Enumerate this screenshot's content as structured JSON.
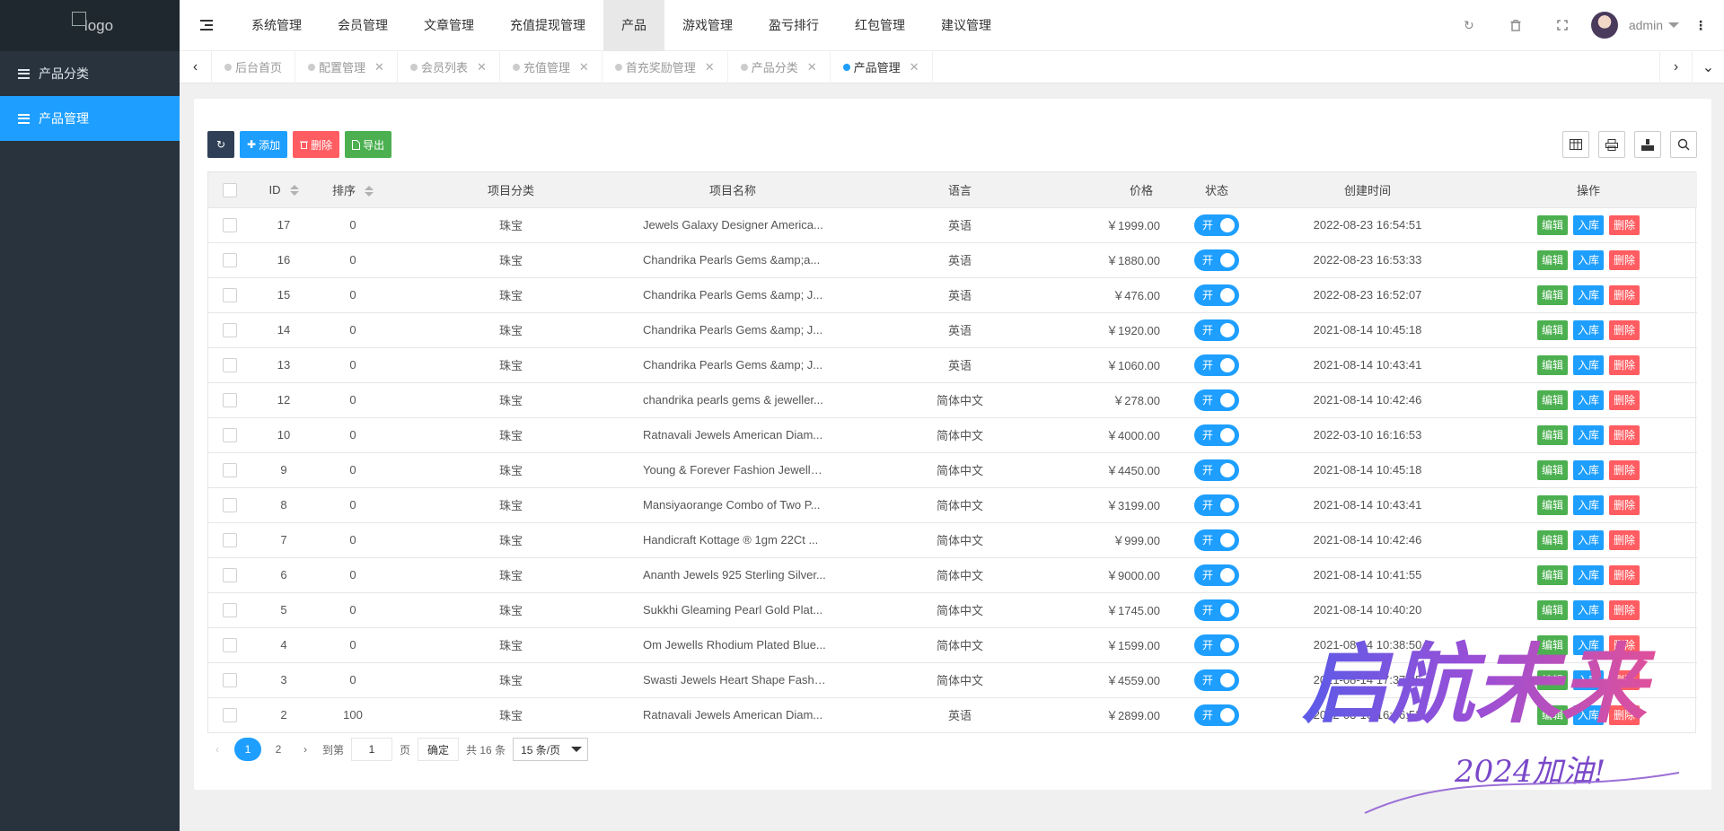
{
  "sidebar": {
    "logo_alt": "logo",
    "items": [
      {
        "label": "产品分类",
        "active": false
      },
      {
        "label": "产品管理",
        "active": true
      }
    ]
  },
  "header": {
    "nav": [
      {
        "label": "系统管理",
        "active": false
      },
      {
        "label": "会员管理",
        "active": false
      },
      {
        "label": "文章管理",
        "active": false
      },
      {
        "label": "充值提现管理",
        "active": false
      },
      {
        "label": "产品",
        "active": true
      },
      {
        "label": "游戏管理",
        "active": false
      },
      {
        "label": "盈亏排行",
        "active": false
      },
      {
        "label": "红包管理",
        "active": false
      },
      {
        "label": "建议管理",
        "active": false
      }
    ],
    "user": "admin"
  },
  "tabs": [
    {
      "label": "后台首页",
      "active": false
    },
    {
      "label": "配置管理",
      "active": false
    },
    {
      "label": "会员列表",
      "active": false
    },
    {
      "label": "充值管理",
      "active": false
    },
    {
      "label": "首充奖励管理",
      "active": false
    },
    {
      "label": "产品分类",
      "active": false
    },
    {
      "label": "产品管理",
      "active": true
    }
  ],
  "toolbar": {
    "add_label": "添加",
    "delete_label": "删除",
    "export_label": "导出"
  },
  "table": {
    "headers": {
      "id": "ID",
      "sort": "排序",
      "category": "项目分类",
      "name": "项目名称",
      "language": "语言",
      "price": "价格",
      "status": "状态",
      "created": "创建时间",
      "actions": "操作"
    },
    "switch_on_label": "开",
    "action_labels": {
      "edit": "编辑",
      "stock": "入库",
      "delete": "删除"
    },
    "rows": [
      {
        "id": "17",
        "sort": "0",
        "category": "珠宝",
        "name": "Jewels Galaxy Designer America...",
        "language": "英语",
        "price": "￥1999.00",
        "created": "2022-08-23 16:54:51"
      },
      {
        "id": "16",
        "sort": "0",
        "category": "珠宝",
        "name": "Chandrika Pearls Gems &amp;a...",
        "language": "英语",
        "price": "￥1880.00",
        "created": "2022-08-23 16:53:33"
      },
      {
        "id": "15",
        "sort": "0",
        "category": "珠宝",
        "name": "Chandrika Pearls Gems &amp; J...",
        "language": "英语",
        "price": "￥476.00",
        "created": "2022-08-23 16:52:07"
      },
      {
        "id": "14",
        "sort": "0",
        "category": "珠宝",
        "name": "Chandrika Pearls Gems &amp; J...",
        "language": "英语",
        "price": "￥1920.00",
        "created": "2021-08-14 10:45:18"
      },
      {
        "id": "13",
        "sort": "0",
        "category": "珠宝",
        "name": "Chandrika Pearls Gems &amp; J...",
        "language": "英语",
        "price": "￥1060.00",
        "created": "2021-08-14 10:43:41"
      },
      {
        "id": "12",
        "sort": "0",
        "category": "珠宝",
        "name": "chandrika pearls gems & jeweller...",
        "language": "简体中文",
        "price": "￥278.00",
        "created": "2021-08-14 10:42:46"
      },
      {
        "id": "10",
        "sort": "0",
        "category": "珠宝",
        "name": "Ratnavali Jewels American Diam...",
        "language": "简体中文",
        "price": "￥4000.00",
        "created": "2022-03-10 16:16:53"
      },
      {
        "id": "9",
        "sort": "0",
        "category": "珠宝",
        "name": "Young & Forever Fashion Jewelle...",
        "language": "简体中文",
        "price": "￥4450.00",
        "created": "2021-08-14 10:45:18"
      },
      {
        "id": "8",
        "sort": "0",
        "category": "珠宝",
        "name": "Mansiyaorange Combo of Two P...",
        "language": "简体中文",
        "price": "￥3199.00",
        "created": "2021-08-14 10:43:41"
      },
      {
        "id": "7",
        "sort": "0",
        "category": "珠宝",
        "name": "Handicraft Kottage ® 1gm 22Ct ...",
        "language": "简体中文",
        "price": "￥999.00",
        "created": "2021-08-14 10:42:46"
      },
      {
        "id": "6",
        "sort": "0",
        "category": "珠宝",
        "name": "Ananth Jewels 925 Sterling Silver...",
        "language": "简体中文",
        "price": "￥9000.00",
        "created": "2021-08-14 10:41:55"
      },
      {
        "id": "5",
        "sort": "0",
        "category": "珠宝",
        "name": "Sukkhi Gleaming Pearl Gold Plat...",
        "language": "简体中文",
        "price": "￥1745.00",
        "created": "2021-08-14 10:40:20"
      },
      {
        "id": "4",
        "sort": "0",
        "category": "珠宝",
        "name": "Om Jewells Rhodium Plated Blue...",
        "language": "简体中文",
        "price": "￥1599.00",
        "created": "2021-08-14 10:38:50"
      },
      {
        "id": "3",
        "sort": "0",
        "category": "珠宝",
        "name": "Swasti Jewels Heart Shape Fashi...",
        "language": "简体中文",
        "price": "￥4559.00",
        "created": "2021-08-14 17:37:35"
      },
      {
        "id": "2",
        "sort": "100",
        "category": "珠宝",
        "name": "Ratnavali Jewels American Diam...",
        "language": "英语",
        "price": "￥2899.00",
        "created": "2022-03-10 16:16:53"
      }
    ]
  },
  "pager": {
    "current": "1",
    "page2": "2",
    "goto_label": "到第",
    "page_input": "1",
    "page_unit": "页",
    "confirm_label": "确定",
    "total_label": "共 16 条",
    "per_page": "15 条/页"
  },
  "watermark": {
    "main_text": "启航未来",
    "sub_text": "2024加油!"
  },
  "colors": {
    "primary": "#1e9fff",
    "danger": "#ff5d62",
    "success": "#4cb050",
    "sidebar": "#28333e"
  }
}
